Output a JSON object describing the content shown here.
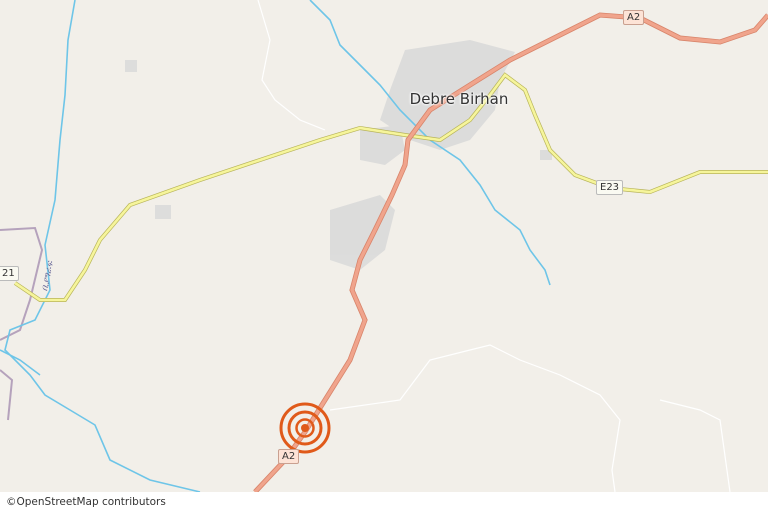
{
  "map": {
    "city_label": "Debre Birhan",
    "road_shields": {
      "a2_north": "A2",
      "a2_south": "A2",
      "e23": "E23",
      "e21_partial": "21"
    },
    "river_label": "ቢያግራፍ",
    "attribution": "©OpenStreetMap contributors",
    "marker": {
      "type": "location-target",
      "color": "#e05a1a"
    },
    "colors": {
      "land": "#f2efe9",
      "primary_road": "#f0a48c",
      "secondary_road": "#f6f59b",
      "river": "#6ec5e8",
      "boundary": "#a58eb0",
      "urban": "#d9d9d9"
    }
  }
}
